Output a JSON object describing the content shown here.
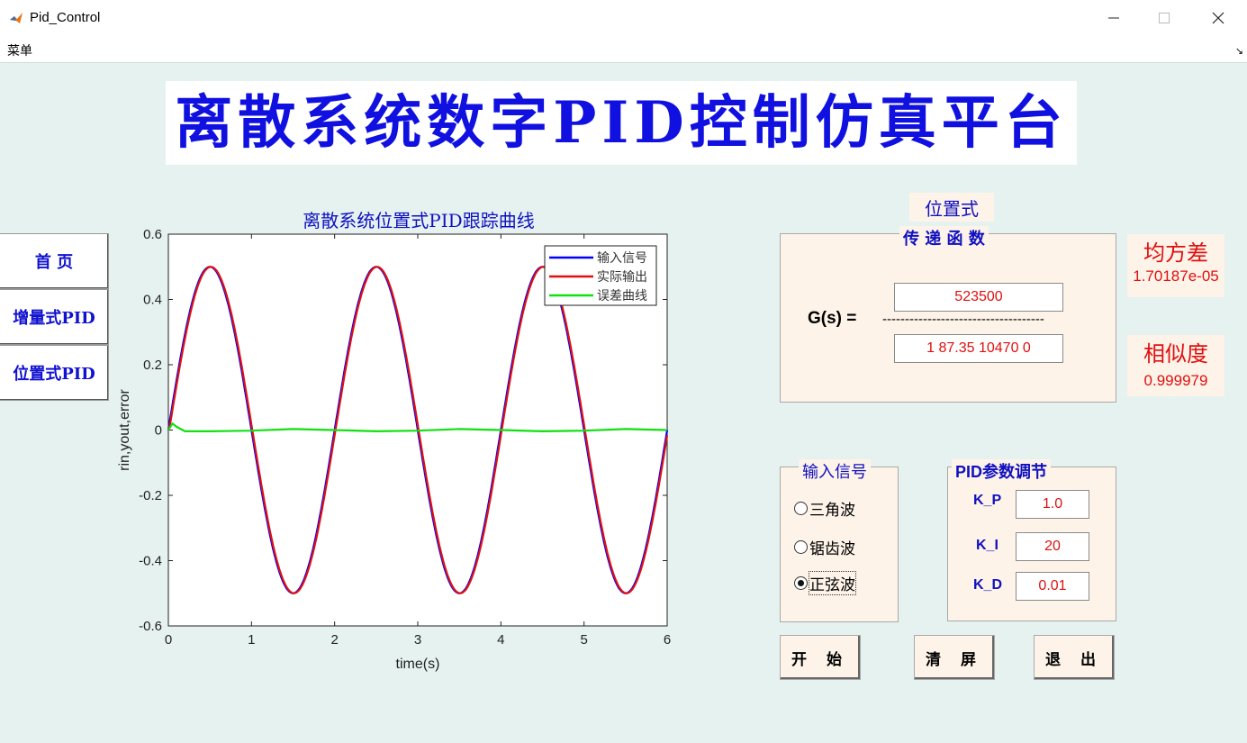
{
  "window": {
    "title": "Pid_Control"
  },
  "menu": {
    "label": "菜单"
  },
  "banner": {
    "title": "离散系统数字PID控制仿真平台"
  },
  "nav": [
    "首 页",
    "增量式PID",
    "位置式PID"
  ],
  "mode_label": "位置式",
  "transfer": {
    "title": "传 递 函 数",
    "lhs": "G(s) =",
    "divider": "------------------------------------",
    "numerator": "523500",
    "denominator": "1 87.35 10470 0"
  },
  "stats": {
    "mse_label": "均方差",
    "mse_value": "1.70187e-05",
    "similarity_label": "相似度",
    "similarity_value": "0.999979"
  },
  "input_signal": {
    "title": "输入信号",
    "options": [
      "三角波",
      "锯齿波",
      "正弦波"
    ],
    "selected": "正弦波"
  },
  "pid": {
    "title": "PID参数调节",
    "kp_label": "K_P",
    "kp": "1.0",
    "ki_label": "K_I",
    "ki": "20",
    "kd_label": "K_D",
    "kd": "0.01"
  },
  "buttons": {
    "start": "开 始",
    "clear": "清 屏",
    "exit": "退 出"
  },
  "chart_data": {
    "type": "line",
    "title": "离散系统位置式PID跟踪曲线",
    "xlabel": "time(s)",
    "ylabel": "rin,yout,error",
    "xlim": [
      0,
      6
    ],
    "ylim": [
      -0.6,
      0.6
    ],
    "xticks": [
      "0",
      "1",
      "2",
      "3",
      "4",
      "5",
      "6"
    ],
    "yticks": [
      "0.6",
      "0.4",
      "0.2",
      "0",
      "-0.2",
      "-0.4",
      "-0.6"
    ],
    "legend_position": "top-right",
    "grid": false,
    "series": [
      {
        "name": "输入信号",
        "color": "#0000ff",
        "formula": "0.5*sin(pi*t)",
        "x": [
          0,
          0.25,
          0.5,
          0.75,
          1,
          1.25,
          1.5,
          1.75,
          2,
          2.25,
          2.5,
          2.75,
          3,
          3.25,
          3.5,
          3.75,
          4,
          4.25,
          4.5,
          4.75,
          5,
          5.25,
          5.5,
          5.75,
          6
        ],
        "y": [
          0,
          0.354,
          0.5,
          0.354,
          0,
          -0.354,
          -0.5,
          -0.354,
          0,
          0.354,
          0.5,
          0.354,
          0,
          -0.354,
          -0.5,
          -0.354,
          0,
          0.354,
          0.5,
          0.354,
          0,
          -0.354,
          -0.5,
          -0.354,
          0
        ]
      },
      {
        "name": "实际输出",
        "color": "#e01010",
        "x": [
          0,
          0.25,
          0.5,
          0.75,
          1,
          1.25,
          1.5,
          1.75,
          2,
          2.25,
          2.5,
          2.75,
          3,
          3.25,
          3.5,
          3.75,
          4,
          4.25,
          4.5,
          4.75,
          5,
          5.25,
          5.5,
          5.75,
          6
        ],
        "y": [
          0,
          0.351,
          0.5,
          0.357,
          0.005,
          -0.35,
          -0.5,
          -0.357,
          -0.005,
          0.35,
          0.5,
          0.357,
          0.005,
          -0.35,
          -0.5,
          -0.357,
          -0.005,
          0.35,
          0.5,
          0.357,
          0.005,
          -0.35,
          -0.5,
          -0.357,
          -0.005
        ]
      },
      {
        "name": "误差曲线",
        "color": "#11e011",
        "x": [
          0,
          0.05,
          0.1,
          0.2,
          0.5,
          1,
          1.5,
          2,
          2.5,
          3,
          3.5,
          4,
          4.5,
          5,
          5.5,
          6
        ],
        "y": [
          0,
          0.02,
          0.01,
          -0.004,
          -0.004,
          -0.002,
          0.003,
          0.0,
          -0.004,
          -0.002,
          0.003,
          0.0,
          -0.004,
          -0.002,
          0.003,
          0.0
        ]
      }
    ]
  }
}
